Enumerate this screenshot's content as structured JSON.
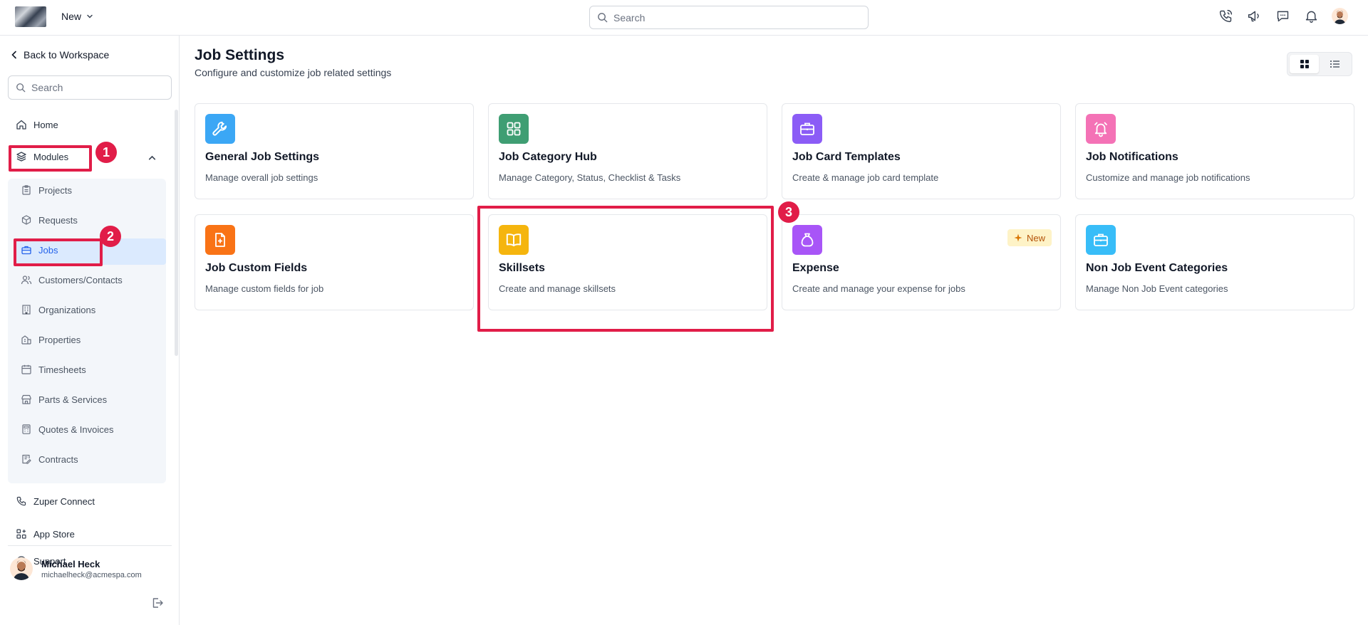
{
  "topbar": {
    "new_label": "New",
    "search_placeholder": "Search",
    "icons": [
      "phone-icon",
      "megaphone-icon",
      "chat-icon",
      "bell-icon",
      "user-avatar"
    ]
  },
  "sidebar": {
    "back_label": "Back to Workspace",
    "search_placeholder": "Search",
    "home": "Home",
    "modules": "Modules",
    "sub_items": [
      {
        "label": "Projects",
        "icon": "clipboard-icon"
      },
      {
        "label": "Requests",
        "icon": "box-icon"
      },
      {
        "label": "Jobs",
        "icon": "briefcase-icon",
        "active": true
      },
      {
        "label": "Customers/Contacts",
        "icon": "users-icon"
      },
      {
        "label": "Organizations",
        "icon": "building-icon"
      },
      {
        "label": "Properties",
        "icon": "property-icon"
      },
      {
        "label": "Timesheets",
        "icon": "calendar-icon"
      },
      {
        "label": "Parts & Services",
        "icon": "store-icon"
      },
      {
        "label": "Quotes & Invoices",
        "icon": "calculator-icon"
      },
      {
        "label": "Contracts",
        "icon": "contract-icon"
      }
    ],
    "zuper_connect": "Zuper Connect",
    "app_store": "App Store",
    "support": "Support",
    "user": {
      "name": "Michael Heck",
      "email": "michaelheck@acmespa.com"
    }
  },
  "annotations": [
    "1",
    "2",
    "3"
  ],
  "main": {
    "title": "Job Settings",
    "subtitle": "Configure and customize job related settings",
    "cards": [
      {
        "title": "General Job Settings",
        "desc": "Manage overall job settings",
        "icon": "wrench-icon",
        "color": "#3ba7f5"
      },
      {
        "title": "Job Category Hub",
        "desc": "Manage Category, Status, Checklist & Tasks",
        "icon": "grid-icon",
        "color": "#3f9e73"
      },
      {
        "title": "Job Card Templates",
        "desc": "Create & manage job card template",
        "icon": "briefcase-icon",
        "color": "#8b5cf6"
      },
      {
        "title": "Job Notifications",
        "desc": "Customize and manage job notifications",
        "icon": "bell-icon",
        "color": "#f472b6"
      },
      {
        "title": "Job Custom Fields",
        "desc": "Manage custom fields for job",
        "icon": "file-plus-icon",
        "color": "#f97316"
      },
      {
        "title": "Skillsets",
        "desc": "Create and manage skillsets",
        "icon": "book-icon",
        "color": "#f5b50e"
      },
      {
        "title": "Expense",
        "desc": "Create and manage your expense for jobs",
        "icon": "money-bag-icon",
        "color": "#a855f7",
        "badge": "New"
      },
      {
        "title": "Non Job Event Categories",
        "desc": "Manage Non Job Event categories",
        "icon": "briefcase-icon",
        "color": "#38bdf8"
      }
    ]
  }
}
